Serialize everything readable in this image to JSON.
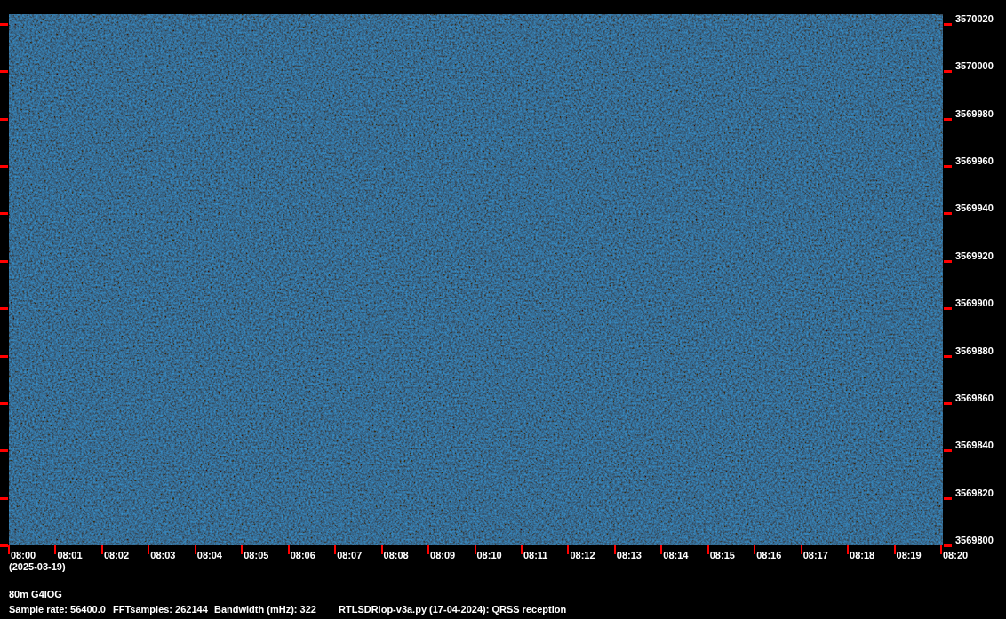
{
  "plot": {
    "y_axis_labels": [
      "3570020",
      "3570000",
      "3569980",
      "3569960",
      "3569940",
      "3569920",
      "3569900",
      "3569880",
      "3569860",
      "3569840",
      "3569820",
      "3569800"
    ],
    "x_axis_labels": [
      "08:00",
      "08:01",
      "08:02",
      "08:03",
      "08:04",
      "08:05",
      "08:06",
      "08:07",
      "08:08",
      "08:09",
      "08:10",
      "08:11",
      "08:12",
      "08:13",
      "08:14",
      "08:15",
      "08:16",
      "08:17",
      "08:18",
      "08:19",
      "08:20"
    ],
    "date": "(2025-03-19)"
  },
  "station": "80m G4IOG",
  "info": [
    "Sample rate: 56400.0",
    "FFTsamples: 262144",
    "Bandwidth (mHz): 322",
    "RTLSDRlop-v3a.py (17-04-2024): QRSS reception"
  ]
}
